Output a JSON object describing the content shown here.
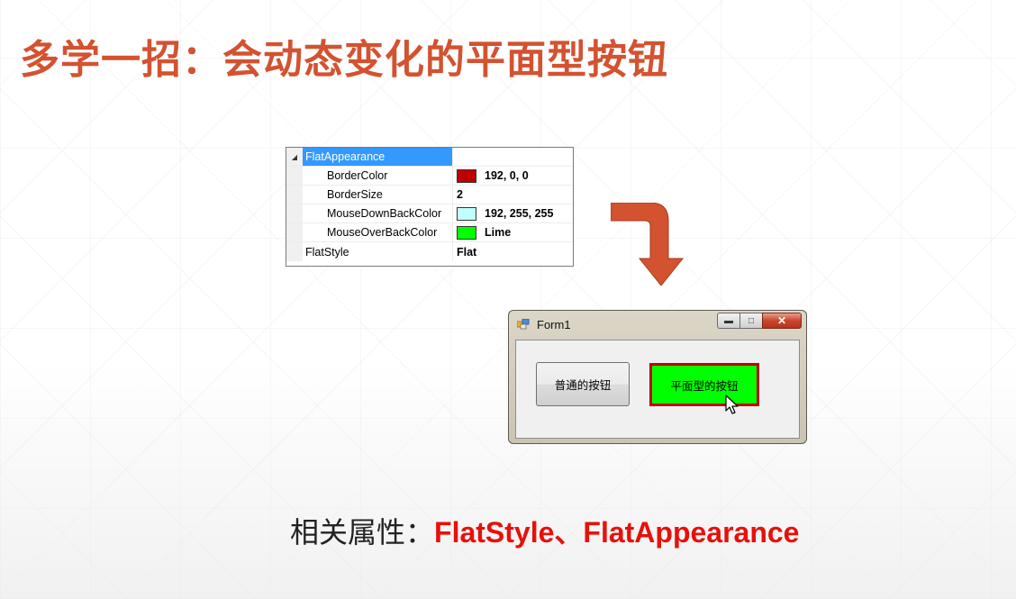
{
  "slide": {
    "title": "多学一招：会动态变化的平面型按钮",
    "title_color": "#d35230"
  },
  "property_grid": {
    "rows": [
      {
        "name": "FlatAppearance",
        "value": "",
        "expanded": true,
        "selected": true
      },
      {
        "name": "BorderColor",
        "value": "192, 0, 0",
        "swatch": "#c00000"
      },
      {
        "name": "BorderSize",
        "value": "2"
      },
      {
        "name": "MouseDownBackColor",
        "value": "192, 255, 255",
        "swatch": "#c0ffff"
      },
      {
        "name": "MouseOverBackColor",
        "value": "Lime",
        "swatch": "#00ff00"
      },
      {
        "name": "FlatStyle",
        "value": "Flat"
      }
    ]
  },
  "arrow_color": "#d35230",
  "form_window": {
    "title": "Form1",
    "normal_button": "普通的按钮",
    "flat_button": "平面型的按钮",
    "flat_border_color": "#c00000",
    "flat_back_color": "#00ff00"
  },
  "footer": {
    "label": "相关属性：",
    "value": "FlatStyle、FlatAppearance",
    "value_color": "#e8100a"
  }
}
